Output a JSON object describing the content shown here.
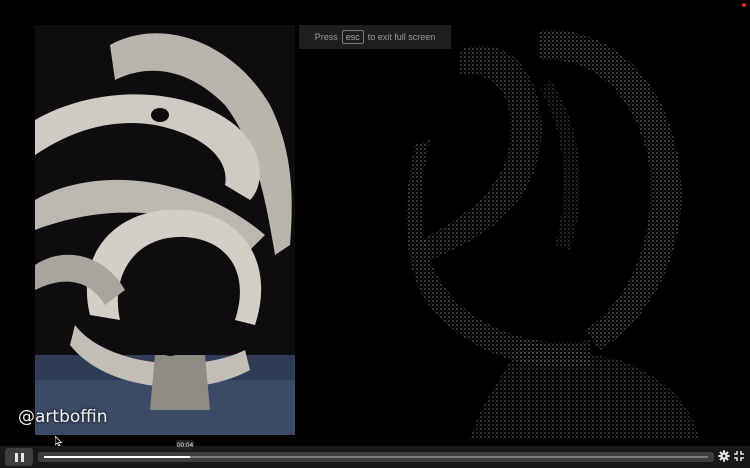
{
  "toast": {
    "press": "Press",
    "key": "esc",
    "suffix": "to exit full screen"
  },
  "watermark": "@artboffin",
  "player": {
    "time_tooltip": "00:04",
    "progress": 0.22,
    "play_state": "paused-icon",
    "settings_icon": "gear-icon",
    "fullscreen_icon": "fullscreen-exit-icon"
  }
}
